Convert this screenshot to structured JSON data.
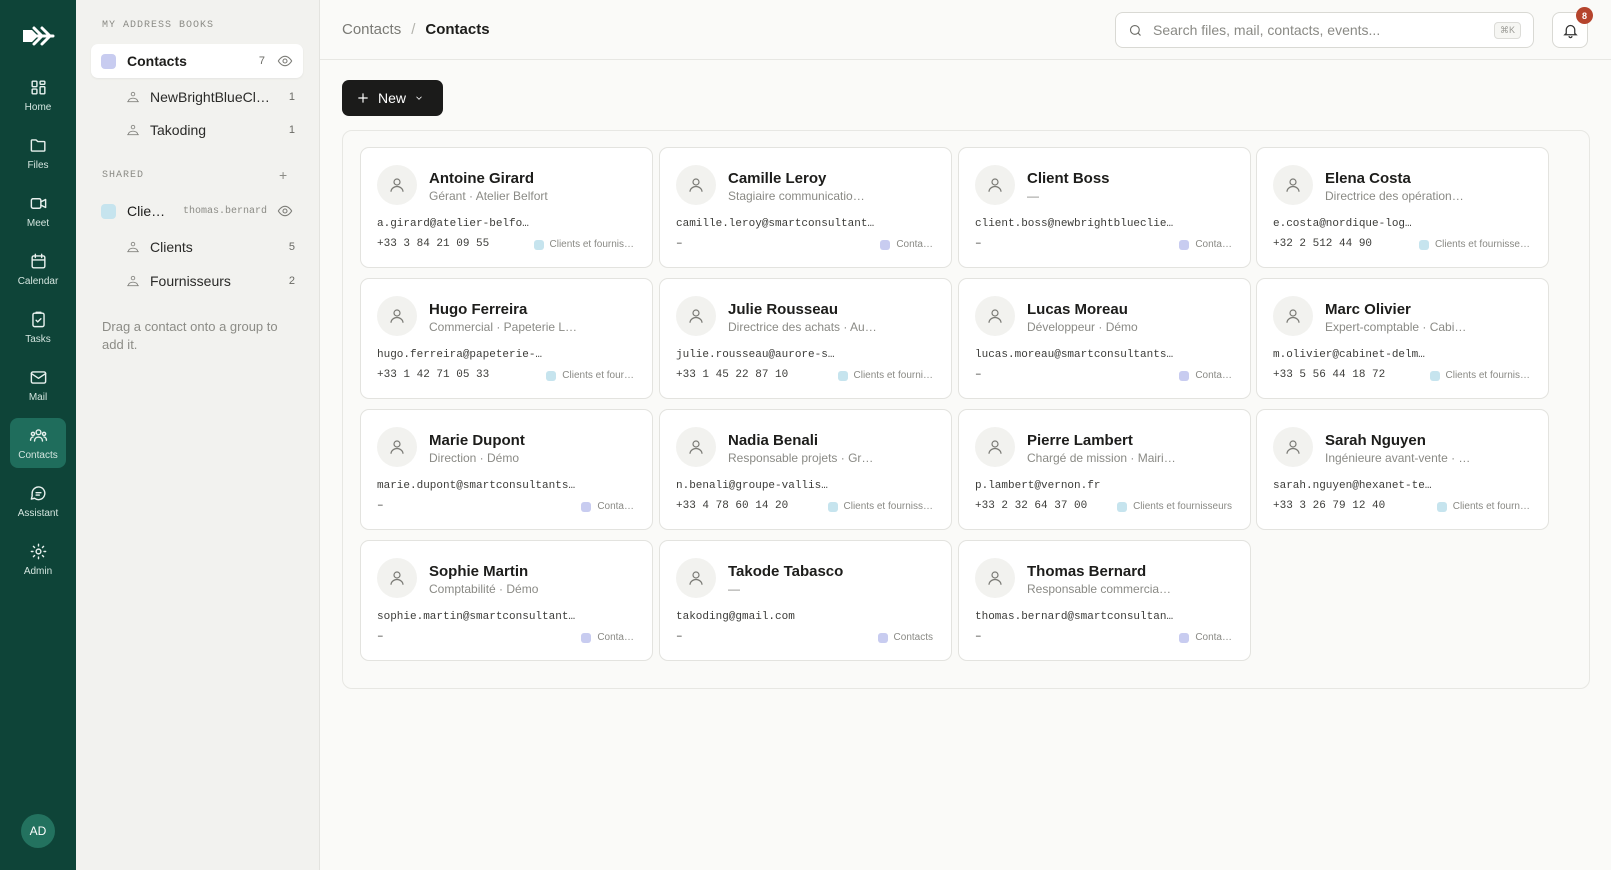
{
  "rail": {
    "items": [
      {
        "label": "Home",
        "icon": "home-icon"
      },
      {
        "label": "Files",
        "icon": "folder-icon"
      },
      {
        "label": "Meet",
        "icon": "video-icon"
      },
      {
        "label": "Calendar",
        "icon": "calendar-icon"
      },
      {
        "label": "Tasks",
        "icon": "clipboard-icon"
      },
      {
        "label": "Mail",
        "icon": "mail-icon"
      },
      {
        "label": "Contacts",
        "icon": "users-icon"
      },
      {
        "label": "Assistant",
        "icon": "chat-icon"
      },
      {
        "label": "Admin",
        "icon": "gear-icon"
      }
    ],
    "active": "Contacts",
    "user_initials": "AD"
  },
  "sidebar": {
    "my_books_title": "MY ADDRESS BOOKS",
    "contacts_book": {
      "name": "Contacts",
      "count": "7",
      "color": "#c8ccf0"
    },
    "contacts_groups": [
      {
        "name": "NewBrightBlueCli…",
        "count": "1"
      },
      {
        "name": "Takoding",
        "count": "1"
      }
    ],
    "shared_title": "SHARED",
    "shared_add": "+",
    "shared_book": {
      "name": "Clie…",
      "owner": "thomas.bernard",
      "color": "#c6e4ee"
    },
    "shared_groups": [
      {
        "name": "Clients",
        "count": "5"
      },
      {
        "name": "Fournisseurs",
        "count": "2"
      }
    ],
    "hint": "Drag a contact onto a group to add it."
  },
  "header": {
    "crumb_root": "Contacts",
    "crumb_sep": "/",
    "crumb_current": "Contacts",
    "search_placeholder": "Search files, mail, contacts, events...",
    "search_shortcut": "⌘K",
    "notifications_count": "8"
  },
  "toolbar": {
    "new_label": "New"
  },
  "colors": {
    "contacts_tag": "#c8ccf0",
    "shared_tag": "#c6e4ee",
    "rail_bg": "#0e4438",
    "rail_active": "#1f6d5c"
  },
  "contacts": [
    {
      "name": "Antoine Girard",
      "subtitle": "Gérant · Atelier Belfort",
      "email": "a.girard@atelier-belfo…",
      "phone": "+33 3 84 21 09 55",
      "tag": "Clients et fournis…",
      "tag_color": "#c6e4ee"
    },
    {
      "name": "Camille Leroy",
      "subtitle": "Stagiaire communicatio…",
      "email": "camille.leroy@smartconsultants…",
      "phone": "–",
      "tag": "Conta…",
      "tag_color": "#c8ccf0"
    },
    {
      "name": "Client Boss",
      "subtitle": "—",
      "email": "client.boss@newbrightblueclien…",
      "phone": "–",
      "tag": "Conta…",
      "tag_color": "#c8ccf0"
    },
    {
      "name": "Elena Costa",
      "subtitle": "Directrice des opération…",
      "email": "e.costa@nordique-log…",
      "phone": "+32 2 512 44 90",
      "tag": "Clients et fournisse…",
      "tag_color": "#c6e4ee"
    },
    {
      "name": "Hugo Ferreira",
      "subtitle": "Commercial · Papeterie L…",
      "email": "hugo.ferreira@papeterie-…",
      "phone": "+33 1 42 71 05 33",
      "tag": "Clients et four…",
      "tag_color": "#c6e4ee"
    },
    {
      "name": "Julie Rousseau",
      "subtitle": "Directrice des achats · Au…",
      "email": "julie.rousseau@aurore-s…",
      "phone": "+33 1 45 22 87 10",
      "tag": "Clients et fourni…",
      "tag_color": "#c6e4ee"
    },
    {
      "name": "Lucas Moreau",
      "subtitle": "Développeur · Démo",
      "email": "lucas.moreau@smartconsultants.…",
      "phone": "–",
      "tag": "Conta…",
      "tag_color": "#c8ccf0"
    },
    {
      "name": "Marc Olivier",
      "subtitle": "Expert-comptable · Cabi…",
      "email": "m.olivier@cabinet-delm…",
      "phone": "+33 5 56 44 18 72",
      "tag": "Clients et fournis…",
      "tag_color": "#c6e4ee"
    },
    {
      "name": "Marie Dupont",
      "subtitle": "Direction · Démo",
      "email": "marie.dupont@smartconsultants.…",
      "phone": "–",
      "tag": "Conta…",
      "tag_color": "#c8ccf0"
    },
    {
      "name": "Nadia Benali",
      "subtitle": "Responsable projets · Gr…",
      "email": "n.benali@groupe-vallis…",
      "phone": "+33 4 78 60 14 20",
      "tag": "Clients et fourniss…",
      "tag_color": "#c6e4ee"
    },
    {
      "name": "Pierre Lambert",
      "subtitle": "Chargé de mission · Mairi…",
      "email": "p.lambert@vernon.fr",
      "phone": "+33 2 32 64 37 00",
      "tag": "Clients et fournisseurs",
      "tag_color": "#c6e4ee"
    },
    {
      "name": "Sarah Nguyen",
      "subtitle": "Ingénieure avant-vente · …",
      "email": "sarah.nguyen@hexanet-te…",
      "phone": "+33 3 26 79 12 40",
      "tag": "Clients et fourn…",
      "tag_color": "#c6e4ee"
    },
    {
      "name": "Sophie Martin",
      "subtitle": "Comptabilité · Démo",
      "email": "sophie.martin@smartconsultants…",
      "phone": "–",
      "tag": "Conta…",
      "tag_color": "#c8ccf0"
    },
    {
      "name": "Takode Tabasco",
      "subtitle": "—",
      "email": "takoding@gmail.com",
      "phone": "–",
      "tag": "Contacts",
      "tag_color": "#c8ccf0"
    },
    {
      "name": "Thomas Bernard",
      "subtitle": "Responsable commercia…",
      "email": "thomas.bernard@smartconsultant…",
      "phone": "–",
      "tag": "Conta…",
      "tag_color": "#c8ccf0"
    }
  ]
}
